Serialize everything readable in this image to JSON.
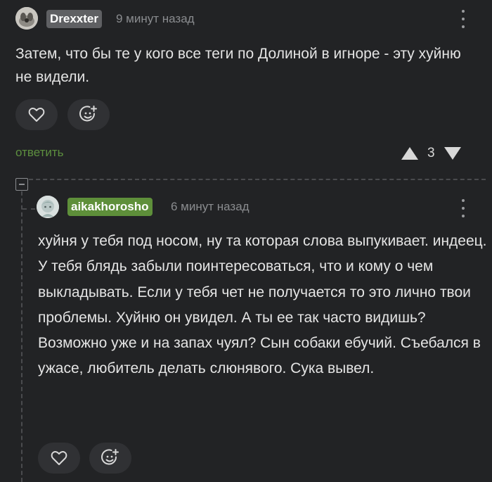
{
  "comment1": {
    "username": "Drexxter",
    "username_color": "#5f6063",
    "time": "9 минут назад",
    "avatar_icon": "avatar-dog-icon",
    "text": "Затем, что бы те у кого все теги по Долиной в игноре - эту хуйню не видели.",
    "reply_label": "ответить",
    "score": "3"
  },
  "comment2": {
    "username": "aikakhorosho",
    "username_color": "#5e8f3a",
    "time": "6 минут назад",
    "avatar_icon": "avatar-anime-icon",
    "text": "хуйня у тебя под носом, ну та которая слова выпукивает. индеец. У тебя блядь забыли поинтересоваться, что и кому о чем выкладывать. Если у тебя чет не получается то это лично твои проблемы. Хуйню он увидел. А ты ее так часто видишь? Возможно уже и на запах чуял? Сын собаки ебучий. Съебался в ужасе, любитель делать слюнявого. Сука вывел."
  },
  "colors": {
    "background": "#222325",
    "accent_green": "#5d8f3f",
    "button_bg": "#303134"
  }
}
